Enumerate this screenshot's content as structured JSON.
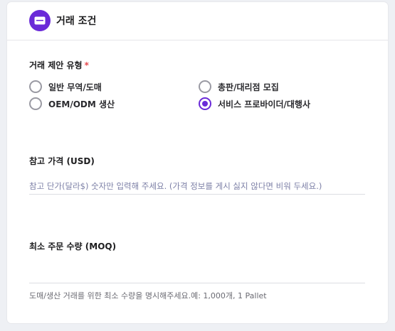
{
  "section": {
    "title": "거래 조건"
  },
  "deal_type": {
    "label": "거래 제안 유형",
    "required_mark": "*",
    "options": [
      {
        "label": "일반 무역/도매",
        "checked": false
      },
      {
        "label": "총판/대리점 모집",
        "checked": false
      },
      {
        "label": "OEM/ODM 생산",
        "checked": false
      },
      {
        "label": "서비스 프로바이더/대행사",
        "checked": true
      }
    ]
  },
  "price": {
    "label": "참고 가격 (USD)",
    "placeholder": "참고 단가(달라$) 숫자만 입력해 주세요. (가격 정보를 게시 싫지 않다면 비워 두세요.)",
    "value": ""
  },
  "moq": {
    "label": "최소 주문 수량 (MOQ)",
    "value": "",
    "hint": "도매/생산 거래를 위한 최소 수량을 명시해주세요.예: 1,000개, 1 Pallet"
  },
  "colors": {
    "accent": "#6a2ad8",
    "required": "#e5484d"
  }
}
